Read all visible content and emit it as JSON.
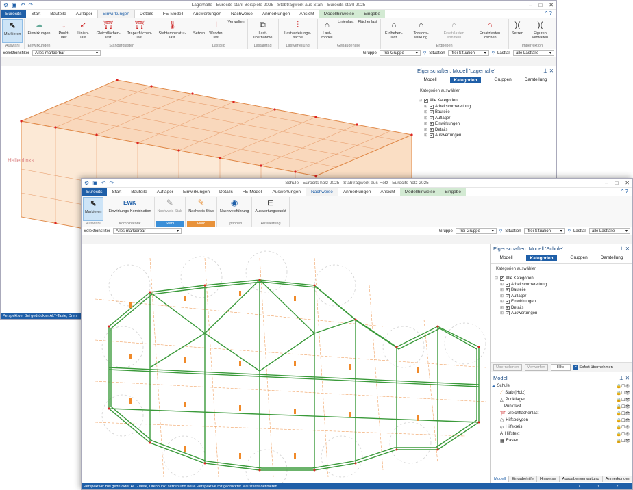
{
  "w1": {
    "title": "Lagerhalle - Eurocits stahl Beispiele 2025 - Stabtragwerk aus Stahl - Eurocits stahl 2025",
    "tabs": [
      "Eurocits",
      "Start",
      "Bauteile",
      "Auflager",
      "Einwirkungen",
      "Details",
      "FE-Modell",
      "Auswertungen",
      "Nachweise",
      "Anmerkungen",
      "Ansicht",
      "Modellhinweise",
      "Eingabe"
    ],
    "ribbon": [
      {
        "label": "Auswahl",
        "buttons": [
          "Markieren"
        ]
      },
      {
        "label": "Einwirkungen",
        "buttons": [
          "Einwirkungen"
        ]
      },
      {
        "label": "Standardlasten",
        "buttons": [
          "Punkt-last",
          "Linien-last",
          "Gleichflächen-last",
          "Trapezflächen-last",
          "Stabtemperatur-last"
        ]
      },
      {
        "label": "Lastbild",
        "buttons": [
          "Setzen",
          "Wander-last",
          "Verwalten"
        ]
      },
      {
        "label": "Lastabtrag",
        "buttons": [
          "Last-übernahme"
        ]
      },
      {
        "label": "Lastverteilung",
        "buttons": [
          "Lastverteilungs-fläche"
        ]
      },
      {
        "label": "Gebäudehülle",
        "buttons": [
          "Last-modell",
          "Linienlast",
          "Flächenlast"
        ]
      },
      {
        "label": "Erdbeben",
        "buttons": [
          "Erdbeben-last",
          "Torsions-wirkung",
          "Ersatzlasten ermitteln",
          "Ersatzlasten löschen"
        ]
      },
      {
        "label": "Imperfektion",
        "buttons": [
          "Setzen",
          "Figuren verwalten"
        ]
      }
    ],
    "filter": {
      "label": "Selektionsfilter",
      "value": "Alles markierbar",
      "gruppe_label": "Gruppe",
      "gruppe": "-frei Gruppe-",
      "situation_label": "Situation",
      "situation": "-frei Situation-",
      "lastfall_label": "Lastfall",
      "lastfall": "alle Lastfälle"
    },
    "panel": {
      "title": "Eigenschaften: Modell 'Lagerhalle'",
      "tabs": [
        "Modell",
        "Kategorien",
        "Gruppen",
        "Darstellung"
      ],
      "section": "Kategorien auswählen",
      "tree": [
        "Alle Kategorien",
        "Arbeitsvorbereitung",
        "Bauteile",
        "Auflager",
        "Einwirkungen",
        "Details",
        "Auswertungen"
      ]
    },
    "status": "Perspektive: Bei gedrückter ALT-Taste, Dreh",
    "labels": [
      "Hallenlinks"
    ]
  },
  "w2": {
    "title": "Schule - Eurocits holz 2025 - Stabtragwerk aus Holz - Eurocits holz 2025",
    "tabs": [
      "Eurocits",
      "Start",
      "Bauteile",
      "Auflager",
      "Einwirkungen",
      "Details",
      "FE-Modell",
      "Auswertungen",
      "Nachweise",
      "Anmerkungen",
      "Ansicht",
      "Modellhinweise",
      "Eingabe"
    ],
    "ribbon": [
      {
        "label": "Auswahl",
        "buttons": [
          "Markieren"
        ]
      },
      {
        "label": "Kombinatorik",
        "buttons": [
          "Einwirkungs-Kombination"
        ],
        "icon_text": "EWK"
      },
      {
        "label": "Stahl",
        "buttons": [
          "Nachweis Stab"
        ],
        "style": "b"
      },
      {
        "label": "Holz",
        "buttons": [
          "Nachweis Stab"
        ],
        "style": "o"
      },
      {
        "label": "Optionen",
        "buttons": [
          "Nachweisführung"
        ]
      },
      {
        "label": "Auswertung",
        "buttons": [
          "Auswertungspunkt"
        ]
      }
    ],
    "filter": {
      "label": "Selektionsfilter",
      "value": "Alles markierbar",
      "gruppe_label": "Gruppe",
      "gruppe": "-frei Gruppe-",
      "situation_label": "Situation",
      "situation": "-frei Situation-",
      "lastfall_label": "Lastfall",
      "lastfall": "alle Lastfälle"
    },
    "panel": {
      "title": "Eigenschaften: Modell 'Schule'",
      "tabs": [
        "Modell",
        "Kategorien",
        "Gruppen",
        "Darstellung"
      ],
      "section": "Kategorien auswählen",
      "tree": [
        "Alle Kategorien",
        "Arbeitsvorbereitung",
        "Bauteile",
        "Auflager",
        "Einwirkungen",
        "Details",
        "Auswertungen"
      ],
      "buttons": [
        "Übernehmen",
        "Verwerfen",
        "Hilfe",
        "Sofort übernehmen"
      ]
    },
    "model": {
      "title": "Modell",
      "root": "Schule",
      "items": [
        "Stab (Holz)",
        "Punktlager",
        "Punktlast",
        "Gleichflächenlast",
        "Hilfspolygon",
        "Hilfskreis",
        "Hilfstext",
        "Raster"
      ]
    },
    "bottom_tabs": [
      "Modell",
      "Eingabehilfe",
      "Hinweise",
      "Ausgabenverwaltung",
      "Anmerkungen"
    ],
    "status": "Perspektive: Bei gedrückter ALT-Taste, Drehpunkt setzen und neue Perspektive mit gedrückter Maustaste definieren",
    "coords": [
      "X",
      "Y",
      "Z"
    ]
  },
  "colors": {
    "accent": "#1f5fa8",
    "holz": "#e8923a",
    "grid": "#3a9a3a"
  }
}
